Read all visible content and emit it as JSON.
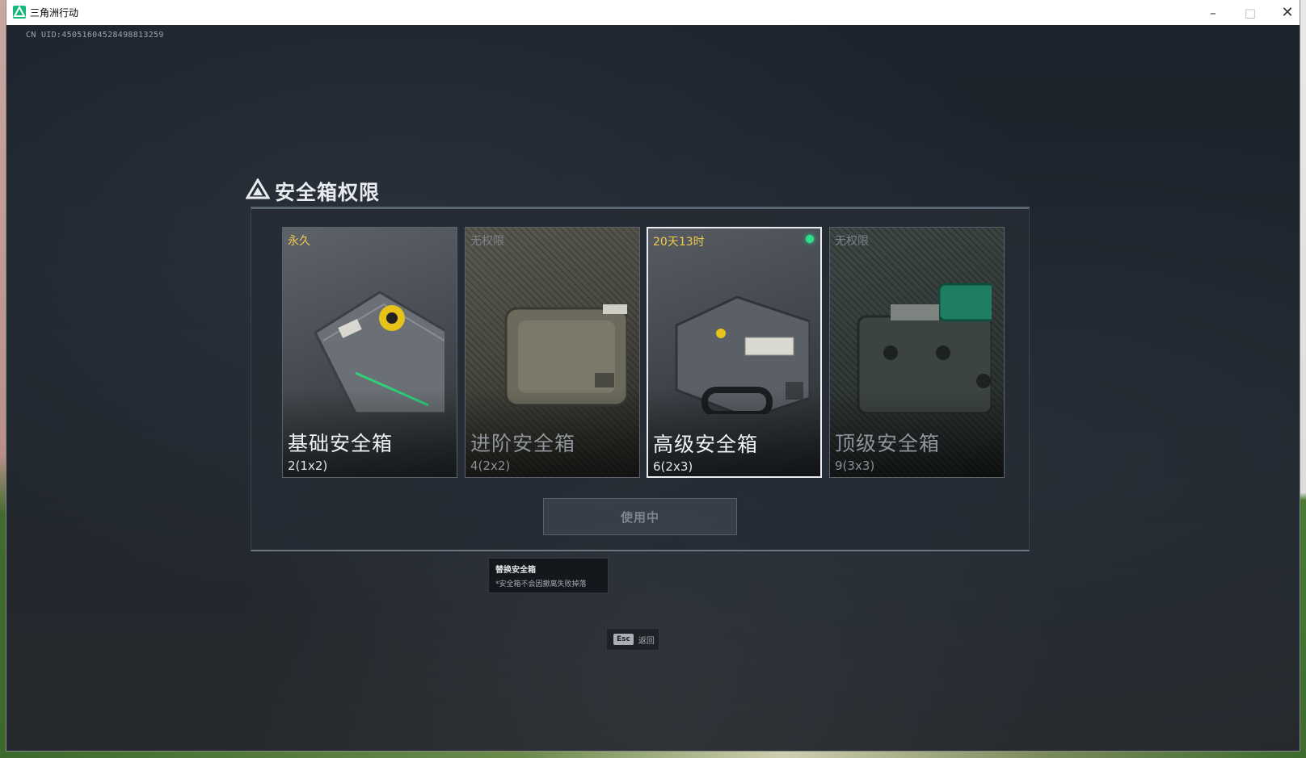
{
  "window": {
    "title": "三角洲行动",
    "minimize": "–",
    "maximize": "□",
    "close": "✕"
  },
  "uid_text": "CN UID:45051604528498813259",
  "panel": {
    "title": "安全箱权限",
    "cards": [
      {
        "status": "永久",
        "name": "基础安全箱",
        "size": "2(1x2)",
        "locked": false,
        "selected": false
      },
      {
        "status": "无权限",
        "name": "进阶安全箱",
        "size": "4(2x2)",
        "locked": true,
        "selected": false
      },
      {
        "status": "20天13时",
        "name": "高级安全箱",
        "size": "6(2x3)",
        "locked": false,
        "selected": true
      },
      {
        "status": "无权限",
        "name": "顶级安全箱",
        "size": "9(3x3)",
        "locked": true,
        "selected": false
      }
    ],
    "action_button": "使用中"
  },
  "tooltip": {
    "title": "替换安全箱",
    "desc": "*安全箱不会因撤离失败掉落"
  },
  "esc_hint": {
    "key": "Esc",
    "label": "返回"
  },
  "colors": {
    "status_active": "#f2c94c",
    "status_locked": "#7c8288",
    "active_indicator": "#2fe08a",
    "app_icon": "#17b67a"
  },
  "icons": [
    "app-logo-icon",
    "delta-logo-icon",
    "active-dot-icon"
  ]
}
